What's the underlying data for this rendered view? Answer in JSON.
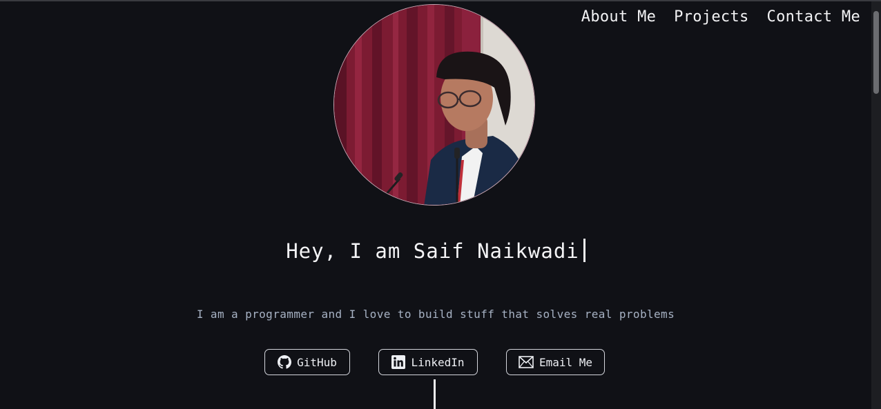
{
  "nav": {
    "about": "About Me",
    "projects": "Projects",
    "contact": "Contact Me"
  },
  "hero": {
    "heading": "Hey, I am Saif Naikwadi",
    "tagline": "I am a programmer and I love to build stuff that solves real problems"
  },
  "buttons": {
    "github": "GitHub",
    "linkedin": "LinkedIn",
    "email": "Email Me"
  },
  "icons": {
    "github": "github-icon",
    "linkedin": "linkedin-icon",
    "email": "envelope-icon"
  },
  "colors": {
    "background": "#101116",
    "text": "#eef0f4",
    "tagline": "#a7b2c4"
  }
}
